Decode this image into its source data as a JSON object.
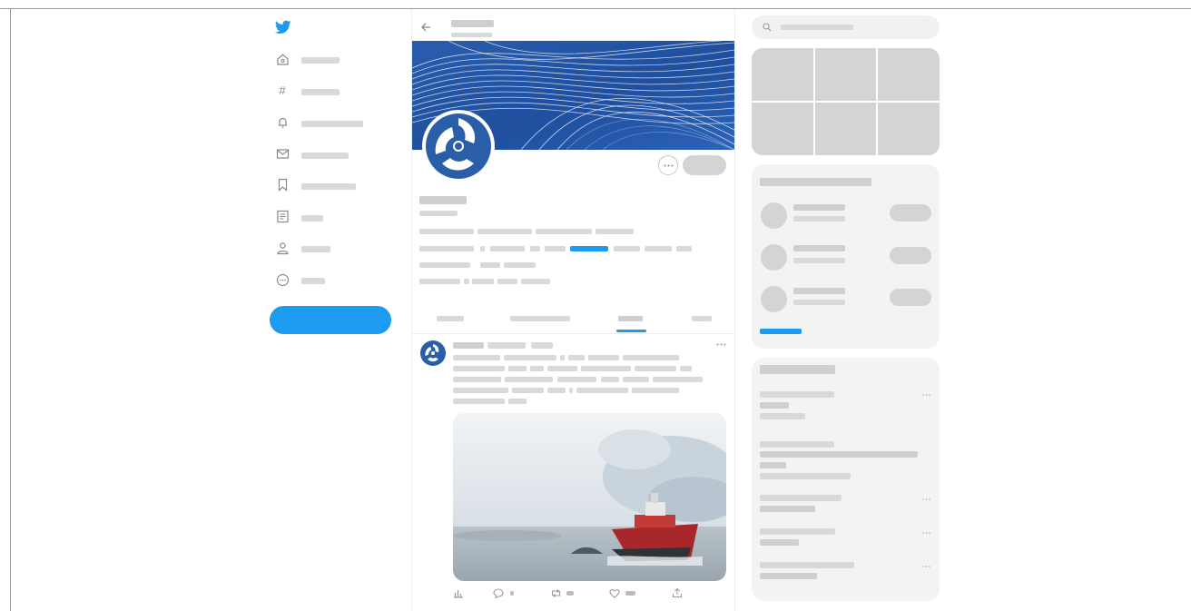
{
  "app": {
    "name": "Twitter",
    "brand_color": "#1d9bf0",
    "skeleton_color": "#d9d9d9",
    "panel_color": "#f2f3f3"
  },
  "sidebar": {
    "logo_icon": "twitter-bird-icon",
    "items": [
      {
        "icon": "home-icon"
      },
      {
        "icon": "hashtag-icon"
      },
      {
        "icon": "bell-icon"
      },
      {
        "icon": "envelope-icon"
      },
      {
        "icon": "bookmark-icon"
      },
      {
        "icon": "list-icon"
      },
      {
        "icon": "profile-icon"
      },
      {
        "icon": "more-circle-icon"
      }
    ]
  },
  "profile": {
    "back_icon": "back-arrow-icon",
    "more_icon": "more-icon",
    "tabs": [
      {
        "active": false
      },
      {
        "active": false
      },
      {
        "active": true
      },
      {
        "active": false
      }
    ]
  },
  "tweet": {
    "more_icon": "more-icon",
    "actions": [
      {
        "icon": "analytics-icon"
      },
      {
        "icon": "reply-icon"
      },
      {
        "icon": "retweet-icon"
      },
      {
        "icon": "like-icon"
      },
      {
        "icon": "share-icon"
      }
    ]
  },
  "right": {
    "search_icon": "search-icon"
  }
}
